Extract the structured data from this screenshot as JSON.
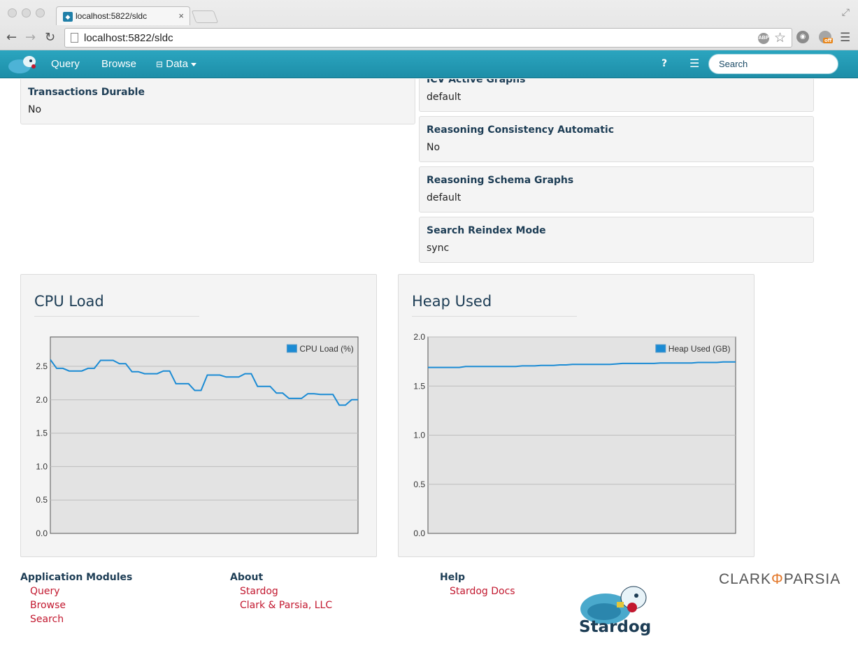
{
  "browser": {
    "tab_title": "localhost:5822/sldc",
    "tab_close": "×",
    "url": "localhost:5822/sldc",
    "ext_badge": "off"
  },
  "navbar": {
    "links": [
      "Query",
      "Browse",
      "Data"
    ],
    "help": "?",
    "search_placeholder": "Search"
  },
  "properties": [
    {
      "label": "Transactions Durable",
      "value": "No"
    },
    {
      "label": "ICV Active Graphs",
      "value": "default"
    },
    {
      "label": "Reasoning Consistency Automatic",
      "value": "No"
    },
    {
      "label": "Reasoning Schema Graphs",
      "value": "default"
    },
    {
      "label": "Search Reindex Mode",
      "value": "sync"
    }
  ],
  "chart_data": [
    {
      "type": "line",
      "title": "CPU Load",
      "series": [
        {
          "name": "CPU Load (%)",
          "color": "#1b8bd4",
          "values": [
            2.6,
            2.47,
            2.47,
            2.43,
            2.43,
            2.43,
            2.47,
            2.47,
            2.59,
            2.59,
            2.59,
            2.54,
            2.54,
            2.42,
            2.42,
            2.39,
            2.39,
            2.39,
            2.43,
            2.43,
            2.24,
            2.24,
            2.24,
            2.14,
            2.14,
            2.37,
            2.37,
            2.37,
            2.34,
            2.34,
            2.34,
            2.39,
            2.39,
            2.2,
            2.2,
            2.2,
            2.1,
            2.1,
            2.02,
            2.02,
            2.02,
            2.09,
            2.09,
            2.08,
            2.08,
            2.08,
            1.92,
            1.92,
            2.0,
            2.0
          ]
        }
      ],
      "yticks": [
        0.0,
        0.5,
        1.0,
        1.5,
        2.0,
        2.5
      ],
      "ylim": [
        0,
        2.94
      ],
      "grid": true,
      "legend": "top-right"
    },
    {
      "type": "line",
      "title": "Heap Used",
      "series": [
        {
          "name": "Heap Used (GB)",
          "color": "#1b8bd4",
          "values": [
            1.69,
            1.69,
            1.69,
            1.69,
            1.69,
            1.69,
            1.7,
            1.7,
            1.7,
            1.7,
            1.7,
            1.7,
            1.7,
            1.7,
            1.7,
            1.705,
            1.705,
            1.705,
            1.71,
            1.71,
            1.71,
            1.715,
            1.715,
            1.72,
            1.72,
            1.72,
            1.72,
            1.72,
            1.72,
            1.72,
            1.725,
            1.73,
            1.73,
            1.73,
            1.73,
            1.73,
            1.73,
            1.735,
            1.735,
            1.735,
            1.735,
            1.735,
            1.735,
            1.74,
            1.74,
            1.74,
            1.74,
            1.745,
            1.745,
            1.745
          ]
        }
      ],
      "yticks": [
        0.0,
        0.5,
        1.0,
        1.5,
        2.0
      ],
      "ylim": [
        0,
        2.0
      ],
      "grid": true,
      "legend": "top-right"
    }
  ],
  "footer": {
    "modules": {
      "heading": "Application Modules",
      "links": [
        "Query",
        "Browse",
        "Search"
      ]
    },
    "about": {
      "heading": "About",
      "links": [
        "Stardog",
        "Clark & Parsia, LLC"
      ]
    },
    "help": {
      "heading": "Help",
      "links": [
        "Stardog Docs"
      ]
    },
    "brand": "Stardog",
    "company_logo": "CLARK PARSIA"
  }
}
